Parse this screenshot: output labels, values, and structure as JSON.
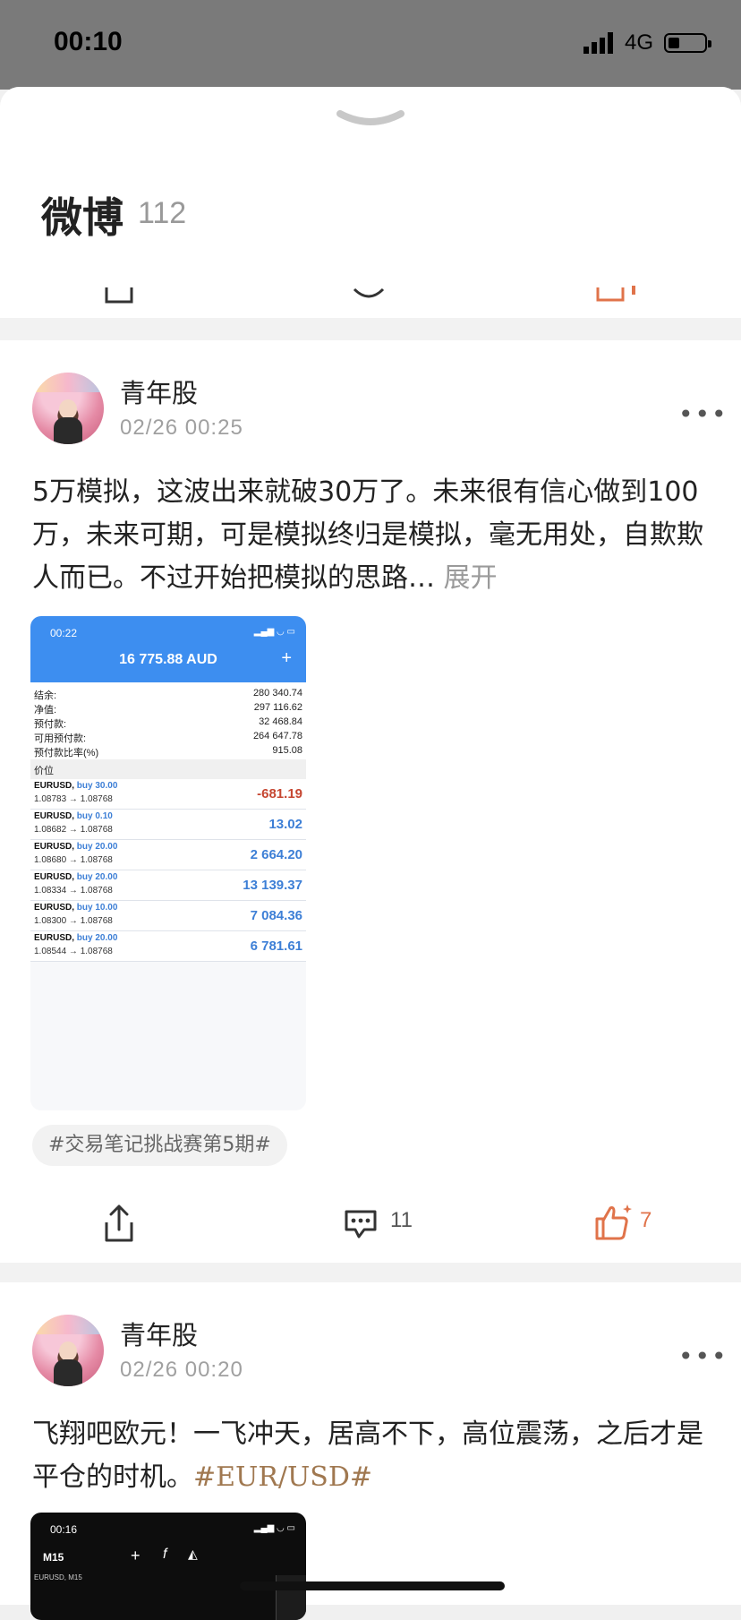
{
  "status_bar": {
    "time": "00:10",
    "network": "4G"
  },
  "sheet": {
    "title": "微博",
    "count": "112"
  },
  "posts": [
    {
      "author": "青年股",
      "date": "02/26 00:25",
      "text": "5万模拟，这波出来就破30万了。未来很有信心做到100万，未来可期，可是模拟终归是模拟，毫无用处，自欺欺人而已。不过开始把模拟的思路…",
      "expand_label": "展开",
      "topic": "#交易笔记挑战赛第5期#",
      "comments": "11",
      "likes": "7",
      "screenshot": {
        "time": "00:22",
        "balance_header": "16 775.88 AUD",
        "plus": "+",
        "account": [
          {
            "label": "结余:",
            "value": "280 340.74"
          },
          {
            "label": "净值:",
            "value": "297 116.62"
          },
          {
            "label": "预付款:",
            "value": "32 468.84"
          },
          {
            "label": "可用预付款:",
            "value": "264 647.78"
          },
          {
            "label": "预付款比率(%)",
            "value": "915.08"
          }
        ],
        "positions_label": "价位",
        "trades": [
          {
            "symbol": "EURUSD,",
            "side": "buy 30.00",
            "prices": "1.08783 → 1.08768",
            "pl": "-681.19",
            "negative": true
          },
          {
            "symbol": "EURUSD,",
            "side": "buy 0.10",
            "prices": "1.08682 → 1.08768",
            "pl": "13.02",
            "negative": false
          },
          {
            "symbol": "EURUSD,",
            "side": "buy 20.00",
            "prices": "1.08680 → 1.08768",
            "pl": "2 664.20",
            "negative": false
          },
          {
            "symbol": "EURUSD,",
            "side": "buy 20.00",
            "prices": "1.08334 → 1.08768",
            "pl": "13 139.37",
            "negative": false
          },
          {
            "symbol": "EURUSD,",
            "side": "buy 10.00",
            "prices": "1.08300 → 1.08768",
            "pl": "7 084.36",
            "negative": false
          },
          {
            "symbol": "EURUSD,",
            "side": "buy 20.00",
            "prices": "1.08544 → 1.08768",
            "pl": "6 781.61",
            "negative": false
          }
        ]
      }
    },
    {
      "author": "青年股",
      "date": "02/26 00:20",
      "text": "飞翔吧欧元！一飞冲天，居高不下，高位震荡，之后才是平仓的时机。",
      "hashtag": "#EUR/USD#",
      "screenshot": {
        "time": "00:16",
        "timeframe": "M15",
        "chart_label": "EURUSD, M15"
      }
    }
  ],
  "colors": {
    "accent": "#e0734a",
    "mt_blue": "#3d8ef0",
    "negative": "#c64631"
  },
  "icons": [
    "chevron-down-icon",
    "share-icon",
    "comment-icon",
    "like-icon",
    "more-icon",
    "signal-icon",
    "battery-icon"
  ]
}
